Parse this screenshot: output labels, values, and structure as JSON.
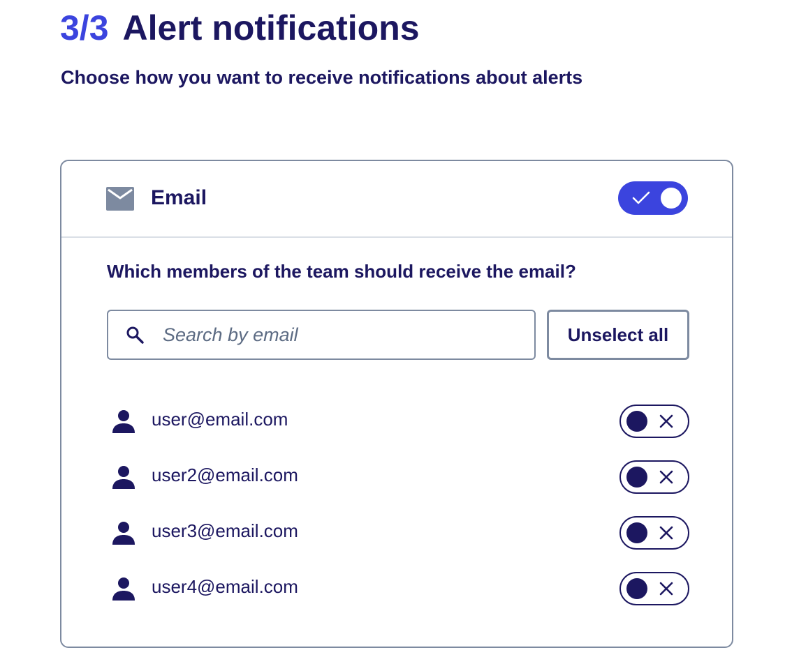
{
  "header": {
    "step": "3/3",
    "title": "Alert notifications",
    "subtitle": "Choose how you want to receive notifications about alerts"
  },
  "email_channel": {
    "label": "Email",
    "icon": "mail-icon",
    "enabled": true,
    "question": "Which members of the team should receive the email?",
    "search": {
      "placeholder": "Search by email",
      "value": "",
      "icon": "search-icon"
    },
    "unselect_all_label": "Unselect all",
    "members": [
      {
        "email": "user@email.com",
        "selected": false
      },
      {
        "email": "user2@email.com",
        "selected": false
      },
      {
        "email": "user3@email.com",
        "selected": false
      },
      {
        "email": "user4@email.com",
        "selected": false
      }
    ]
  },
  "colors": {
    "accent": "#3b44de",
    "text": "#1c1760",
    "border": "#7d8aa0",
    "divider": "#dadfe6",
    "icon_gray": "#7d8aa0"
  }
}
